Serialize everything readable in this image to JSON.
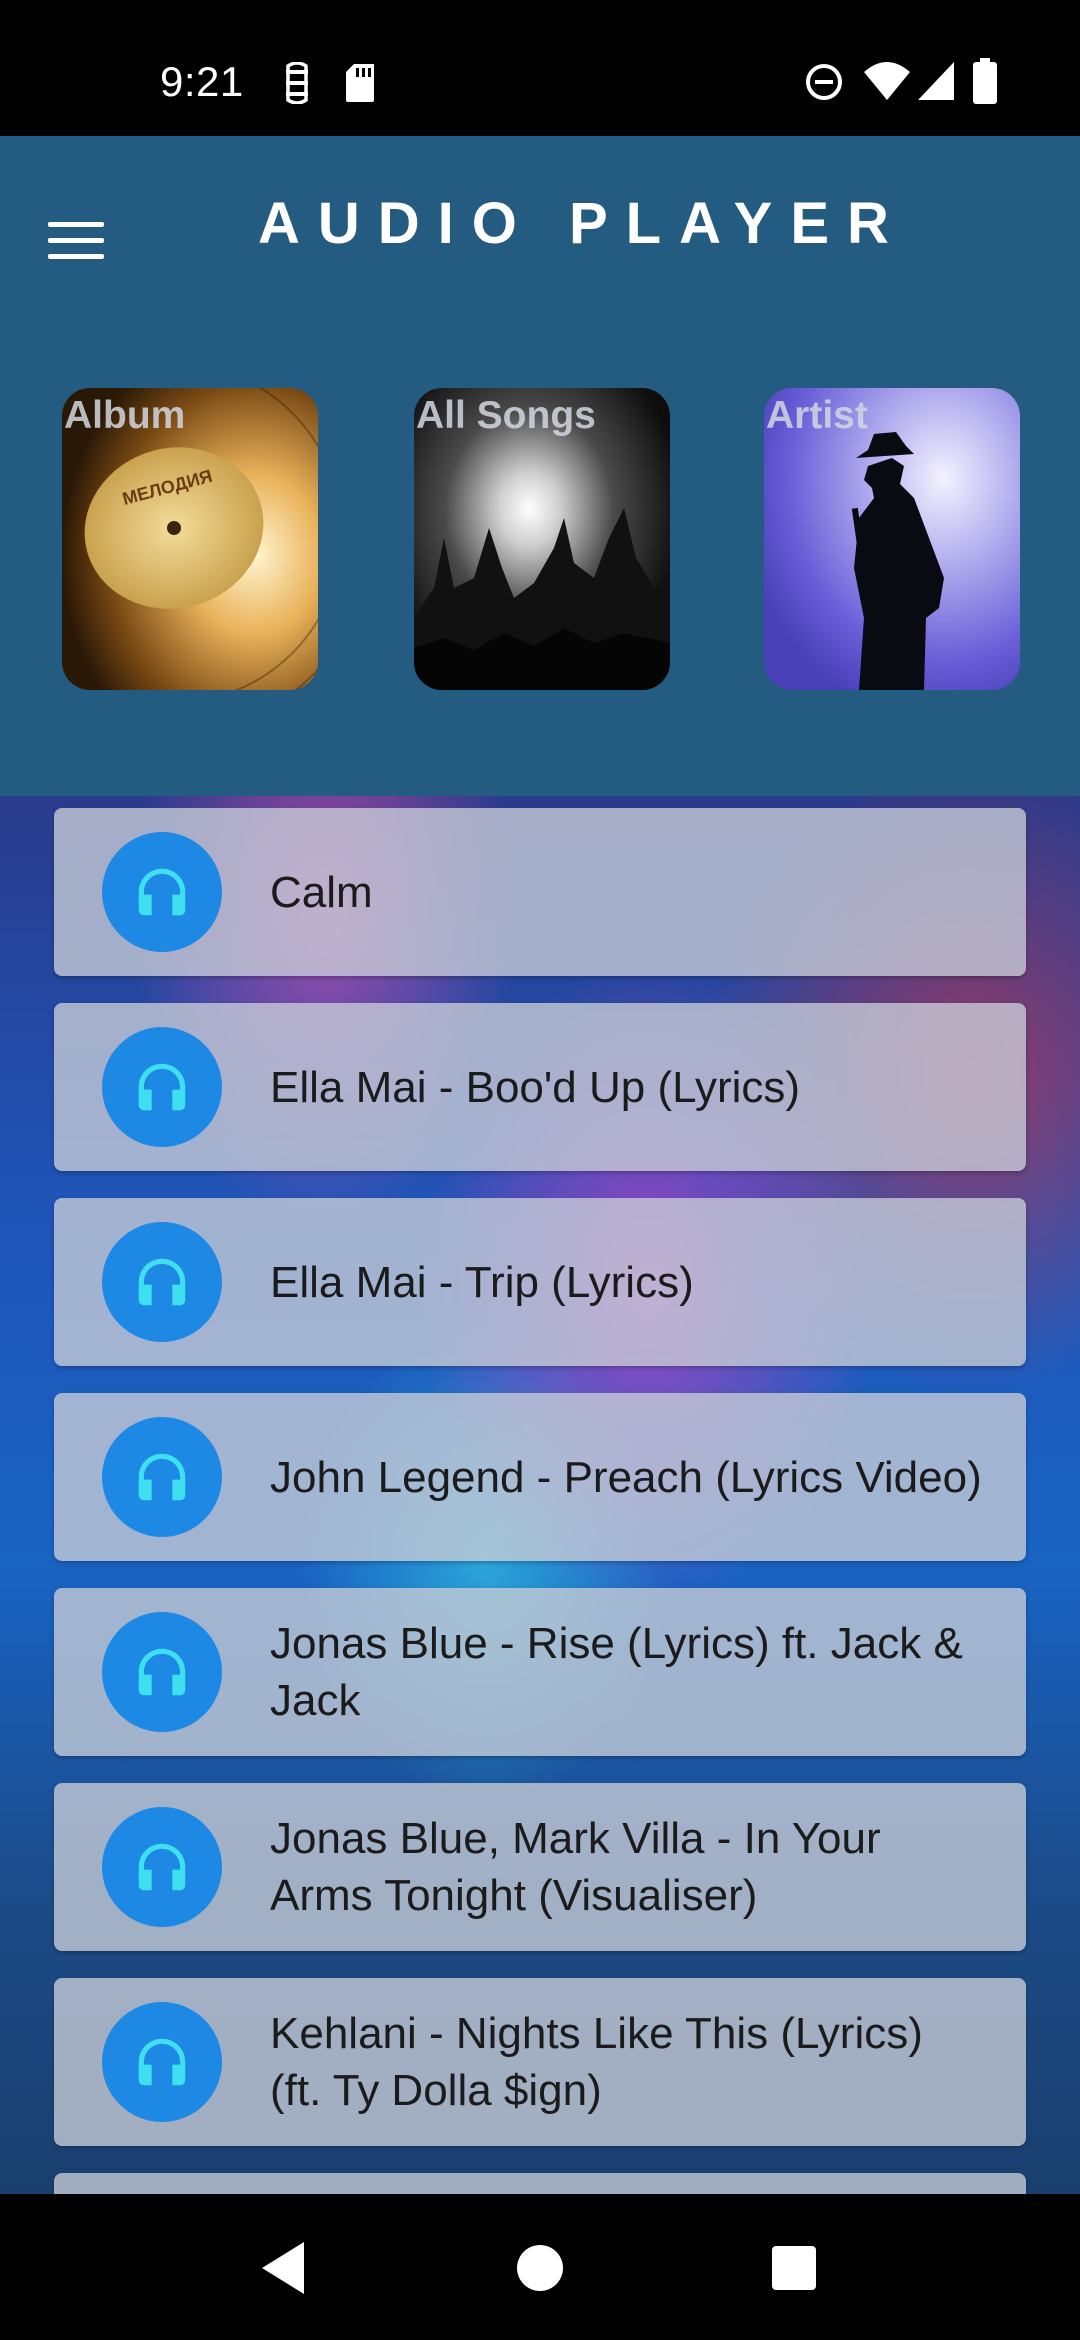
{
  "status_bar": {
    "time": "9:21",
    "icons_left": [
      "sync-icon",
      "sd-card-icon"
    ],
    "icons_right": [
      "do-not-disturb-icon",
      "wifi-icon",
      "signal-icon",
      "battery-icon"
    ]
  },
  "app_bar": {
    "title": "AUDIO PLAYER",
    "menu_icon": "menu-icon"
  },
  "tabs": [
    {
      "label": "Album",
      "image": "vinyl-record"
    },
    {
      "label": "All Songs",
      "image": "concert-crowd",
      "selected": true
    },
    {
      "label": "Artist",
      "image": "singer-silhouette"
    }
  ],
  "songs": [
    {
      "title": "Calm",
      "icon": "headphones-icon"
    },
    {
      "title": "Ella Mai - Boo'd Up (Lyrics)",
      "icon": "headphones-icon"
    },
    {
      "title": "Ella Mai - Trip (Lyrics)",
      "icon": "headphones-icon"
    },
    {
      "title": "John Legend - Preach (Lyrics Video)",
      "icon": "headphones-icon"
    },
    {
      "title": "Jonas Blue - Rise (Lyrics) ft. Jack & Jack",
      "icon": "headphones-icon"
    },
    {
      "title": "Jonas Blue, Mark Villa - In Your Arms Tonight (Visualiser)",
      "icon": "headphones-icon"
    },
    {
      "title": "Kehlani - Nights Like This (Lyrics) (ft. Ty Dolla $ign)",
      "icon": "headphones-icon"
    },
    {
      "title": "",
      "icon": "headphones-icon"
    }
  ],
  "nav_bar": {
    "buttons": [
      "back-icon",
      "home-icon",
      "recents-icon"
    ]
  },
  "colors": {
    "app_bar": "#245b80",
    "avatar": "#1e88e5",
    "headphones": "#3ee0f0",
    "list_item": "#c8cdd7"
  }
}
